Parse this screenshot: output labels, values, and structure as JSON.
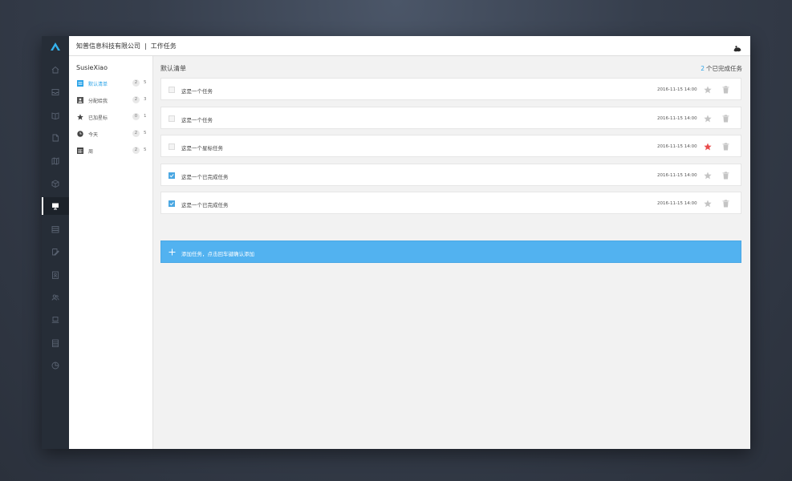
{
  "header": {
    "company": "知普信息科技有限公司",
    "separator": "|",
    "section": "工作任务"
  },
  "rail": {
    "icons": [
      "home-icon",
      "inbox-icon",
      "book-icon",
      "document-icon",
      "map-icon",
      "box-icon",
      "monitor-icon",
      "calendar-icon",
      "edit-icon",
      "contact-icon",
      "users-icon",
      "laptop-icon",
      "table-icon",
      "pie-chart-icon"
    ],
    "active_index": 6
  },
  "sidebar": {
    "user": "SusieXiao",
    "items": [
      {
        "label": "默认清单",
        "count": "2",
        "total": "5",
        "icon": "list-icon",
        "active": true
      },
      {
        "label": "分配给我",
        "count": "2",
        "total": "3",
        "icon": "assign-icon",
        "active": false
      },
      {
        "label": "已加星标",
        "count": "0",
        "total": "1",
        "icon": "star-icon",
        "active": false
      },
      {
        "label": "今天",
        "count": "2",
        "total": "5",
        "icon": "clock-icon",
        "active": false
      },
      {
        "label": "周",
        "count": "2",
        "total": "5",
        "icon": "calendar-week-icon",
        "active": false
      }
    ]
  },
  "main": {
    "list_title": "默认清单",
    "done_count": "2",
    "done_label": "个已完成任务",
    "tasks": [
      {
        "label": "这是一个任务",
        "date": "2016-11-15 14:00",
        "checked": false,
        "starred": false
      },
      {
        "label": "这是一个任务",
        "date": "2016-11-15 14:00",
        "checked": false,
        "starred": false
      },
      {
        "label": "这是一个星标任务",
        "date": "2016-11-15 14:00",
        "checked": false,
        "starred": true
      },
      {
        "label": "这是一个已完成任务",
        "date": "2016-11-15 14:00",
        "checked": true,
        "starred": false
      },
      {
        "label": "这是一个已完成任务",
        "date": "2016-11-15 14:00",
        "checked": true,
        "starred": false
      }
    ],
    "add_placeholder": "添加任务，点击回车键确认添加"
  },
  "colors": {
    "accent": "#2aa3e8",
    "add_bar": "#52b2f0",
    "star_active": "#e94b4b",
    "star_inactive": "#c4c4c4",
    "rail_bg": "#262d37"
  }
}
